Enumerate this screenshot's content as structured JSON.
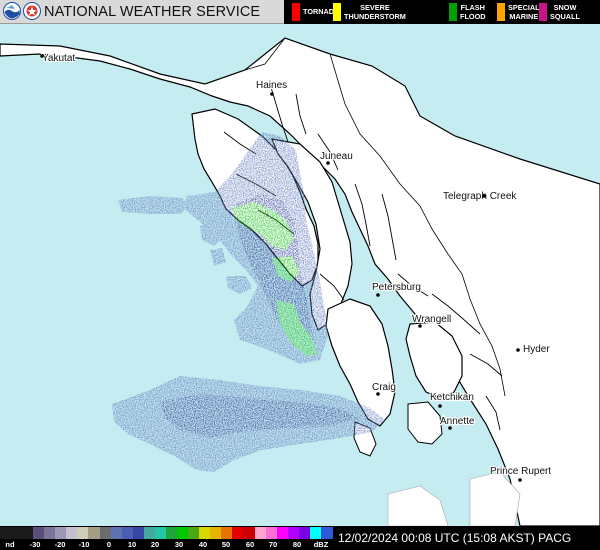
{
  "header": {
    "agency_name": "NATIONAL WEATHER SERVICE",
    "warnings": [
      {
        "label": "TORNADO",
        "color": "#ff0000"
      },
      {
        "label": "SEVERE\nTHUNDERSTORM",
        "color": "#ffff00"
      },
      {
        "label": "FLASH\nFLOOD",
        "color": "#00a000"
      },
      {
        "label": "SPECIAL\nMARINE",
        "color": "#ffa500"
      },
      {
        "label": "SNOW\nSQUALL",
        "color": "#c71585"
      }
    ]
  },
  "places": {
    "yakutat": "Yakutat",
    "haines": "Haines",
    "juneau": "Juneau",
    "telegraph_creek": "Telegraph Creek",
    "petersburg": "Petersburg",
    "wrangell": "Wrangell",
    "hyder": "Hyder",
    "craig": "Craig",
    "ketchikan": "Ketchikan",
    "annette": "Annette",
    "prince_rupert": "Prince Rupert"
  },
  "colors": {
    "ocean": "#c5ecf0",
    "land": "#ffffff",
    "radar_light": "#6f88c6",
    "radar_dark": "#3c4fa0",
    "radar_green": "#2fc72f"
  },
  "legend": {
    "ticks": [
      "nd",
      "-30",
      "-20",
      "-10",
      "0",
      "10",
      "20",
      "30",
      "40",
      "50",
      "60",
      "70",
      "80",
      "dBZ"
    ],
    "colors": [
      "#1a1a1a",
      "#5a4f7a",
      "#7d7399",
      "#9c97b4",
      "#c3bfcf",
      "#cfcdb7",
      "#a59e84",
      "#6b6b70",
      "#5d71b3",
      "#4a5fb1",
      "#3747a6",
      "#45a9a0",
      "#22c7a8",
      "#1fa63a",
      "#00c800",
      "#4aaa13",
      "#d8d800",
      "#e6b400",
      "#e87400",
      "#e50000",
      "#cc0000",
      "#ffa6d0",
      "#ff70d7",
      "#ff00ff",
      "#b000ff",
      "#7a00e6",
      "#00ffff",
      "#2f59d6"
    ],
    "timestamp": "12/02/2024 00:08 UTC (15:08 AKST) PACG"
  }
}
